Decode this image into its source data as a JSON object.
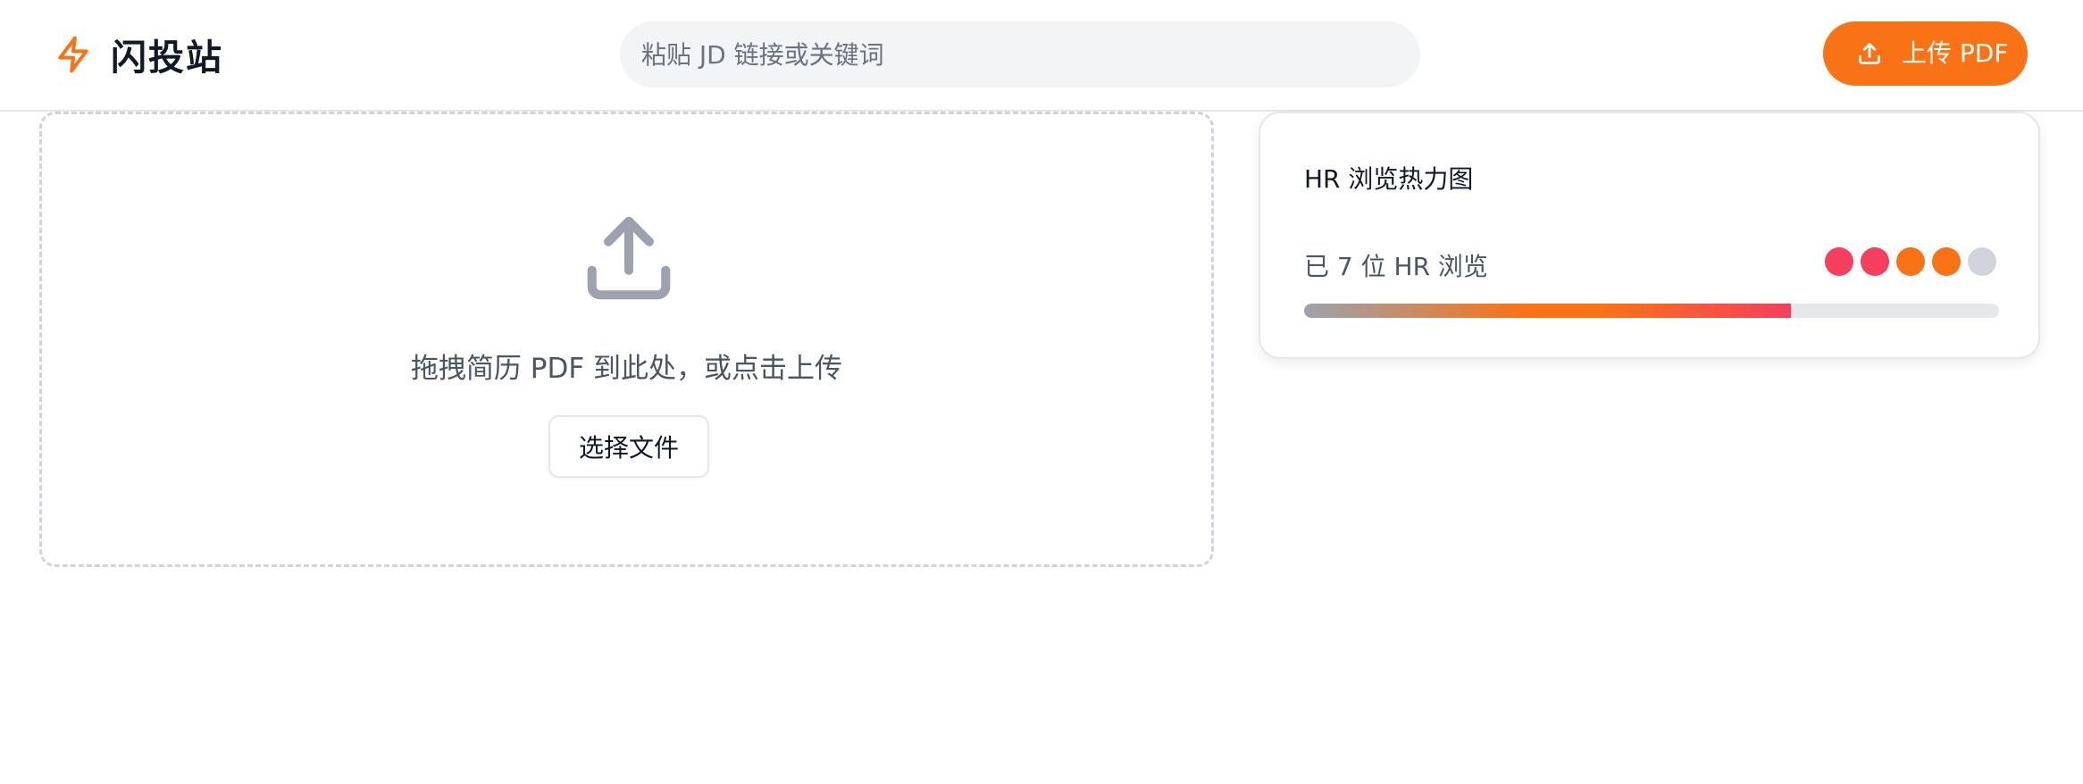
{
  "brand": {
    "name": "闪投站",
    "icon": "lightning-bolt-icon",
    "accent": "#f97316"
  },
  "search": {
    "placeholder": "粘贴 JD 链接或关键词",
    "value": ""
  },
  "header": {
    "upload_label": "上传 PDF",
    "upload_icon": "upload-icon"
  },
  "dropzone": {
    "icon": "upload-icon",
    "hint": "拖拽简历 PDF 到此处，或点击上传",
    "choose_label": "选择文件"
  },
  "heatmap": {
    "title": "HR 浏览热力图",
    "views_text": "已 7 位 HR 浏览",
    "views_count": 7,
    "progress_fraction": 0.7,
    "dots": [
      {
        "color": "#f43f5e"
      },
      {
        "color": "#f43f5e"
      },
      {
        "color": "#f97316"
      },
      {
        "color": "#f97316"
      },
      {
        "color": "#d1d5db"
      }
    ]
  }
}
